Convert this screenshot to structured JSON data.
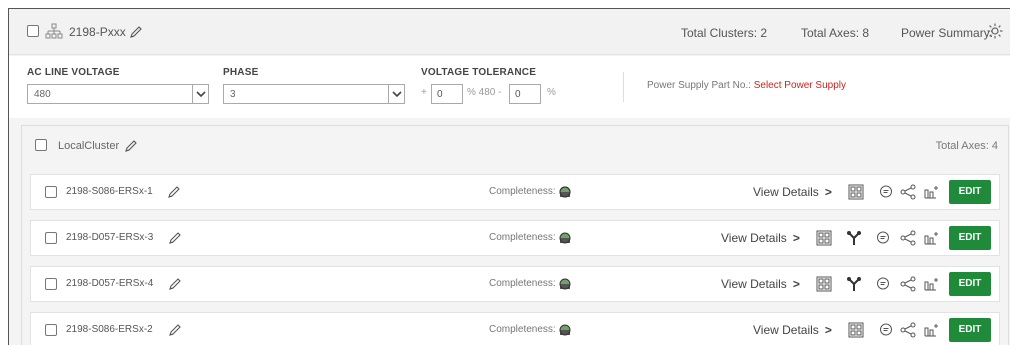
{
  "header": {
    "title": "2198-Pxxx",
    "total_clusters": "Total Clusters: 2",
    "total_axes": "Total Axes: 8",
    "power_summary": "Power Summary:"
  },
  "settings": {
    "ac_line_voltage": {
      "label": "AC LINE VOLTAGE",
      "value": "480"
    },
    "phase": {
      "label": "PHASE",
      "value": "3"
    },
    "voltage_tolerance": {
      "label": "VOLTAGE TOLERANCE",
      "plus_sign": "+",
      "plus_value": "0",
      "mid_text": "% 480 -",
      "minus_value": "0",
      "unit": "%"
    },
    "power_supply": {
      "label": "Power Supply Part No.:",
      "link": "Select Power Supply"
    }
  },
  "cluster": {
    "title": "LocalCluster",
    "total_axes": "Total Axes: 4",
    "view_details_label": "View Details",
    "completeness_label": "Completeness:",
    "edit_label": "EDIT",
    "rows": [
      {
        "name": "2198-S086-ERSx-1"
      },
      {
        "name": "2198-D057-ERSx-3"
      },
      {
        "name": "2198-D057-ERSx-4"
      },
      {
        "name": "2198-S086-ERSx-2"
      }
    ]
  },
  "colors": {
    "accent_green": "#1f8b3a",
    "link_red": "#d0221f"
  },
  "icons": [
    "tree-icon",
    "pencil-icon",
    "sun-icon",
    "chevron-down-icon",
    "status-dot-icon",
    "grid-icon",
    "branch-icon",
    "comment-icon",
    "share-icon",
    "add-chart-icon"
  ]
}
